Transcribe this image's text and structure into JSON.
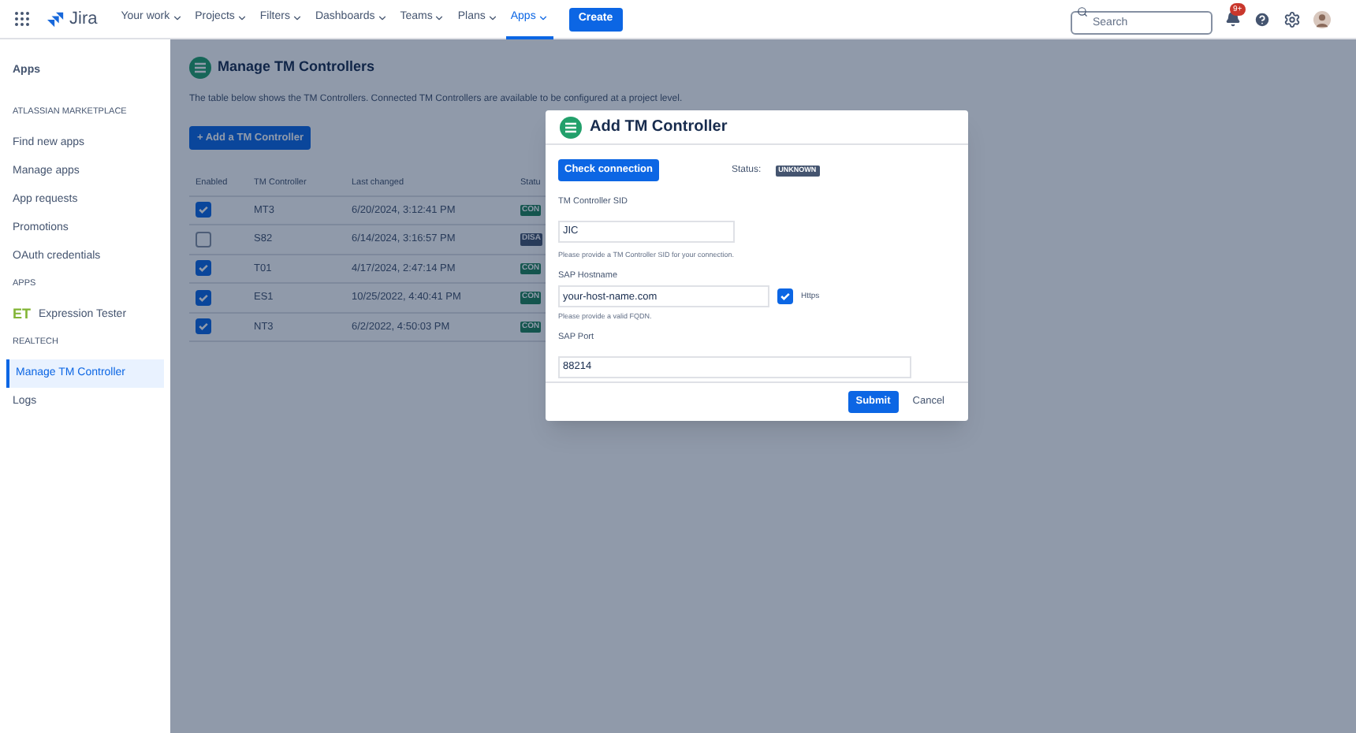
{
  "nav": {
    "product": "Jira",
    "items": [
      {
        "label": "Your work",
        "selected": false
      },
      {
        "label": "Projects",
        "selected": false
      },
      {
        "label": "Filters",
        "selected": false
      },
      {
        "label": "Dashboards",
        "selected": false
      },
      {
        "label": "Teams",
        "selected": false
      },
      {
        "label": "Plans",
        "selected": false
      },
      {
        "label": "Apps",
        "selected": true
      }
    ],
    "create": "Create",
    "search": {
      "placeholder": "Search"
    },
    "notifications": "9+"
  },
  "sidebar": {
    "title": "Apps",
    "sections": [
      {
        "heading": "ATLASSIAN MARKETPLACE",
        "items": [
          {
            "label": "Find new apps",
            "selected": false
          },
          {
            "label": "Manage apps",
            "selected": false
          },
          {
            "label": "App requests",
            "selected": false
          },
          {
            "label": "Promotions",
            "selected": false
          },
          {
            "label": "OAuth credentials",
            "selected": false
          }
        ]
      },
      {
        "heading": "APPS",
        "items": [
          {
            "label": "Expression Tester",
            "selected": false,
            "kind": "app",
            "icon_text": "ET"
          }
        ]
      },
      {
        "heading": "REALTECH",
        "items": [
          {
            "label": "Manage TM Controller",
            "selected": true
          },
          {
            "label": "Logs",
            "selected": false
          }
        ]
      }
    ]
  },
  "page": {
    "title": "Manage TM Controllers",
    "description": "The table below shows the TM Controllers. Connected TM Controllers are available to be configured at a project level.",
    "add_button": "+ Add a TM Controller",
    "table": {
      "columns": [
        "Enabled",
        "TM Controller",
        "Last changed",
        "Statu"
      ],
      "rows": [
        {
          "checked": true,
          "controller": "MT3",
          "changed": "6/20/2024, 3:12:41 PM",
          "status": "CON",
          "kind": "connected"
        },
        {
          "checked": false,
          "controller": "S82",
          "changed": "6/14/2024, 3:16:57 PM",
          "status": "DISA",
          "kind": "disabled"
        },
        {
          "checked": true,
          "controller": "T01",
          "changed": "4/17/2024, 2:47:14 PM",
          "status": "CON",
          "kind": "connected"
        },
        {
          "checked": true,
          "controller": "ES1",
          "changed": "10/25/2022, 4:40:41 PM",
          "status": "CON",
          "kind": "connected"
        },
        {
          "checked": true,
          "controller": "NT3",
          "changed": "6/2/2022, 4:50:03 PM",
          "status": "CON",
          "kind": "connected"
        }
      ]
    }
  },
  "dialog": {
    "title": "Add TM Controller",
    "check_button": "Check connection",
    "status_label": "Status:",
    "status": "UNKNOWN",
    "sid": {
      "label": "TM Controller SID",
      "value": "JIC",
      "help": "Please provide a TM Controller SID for your connection."
    },
    "hostname": {
      "label": "SAP Hostname",
      "value": "your-host-name.com",
      "help": "Please provide a valid FQDN.",
      "https": {
        "label": "Https",
        "checked": true
      }
    },
    "port": {
      "label": "SAP Port",
      "value": "88214"
    },
    "submit": "Submit",
    "cancel": "Cancel"
  }
}
